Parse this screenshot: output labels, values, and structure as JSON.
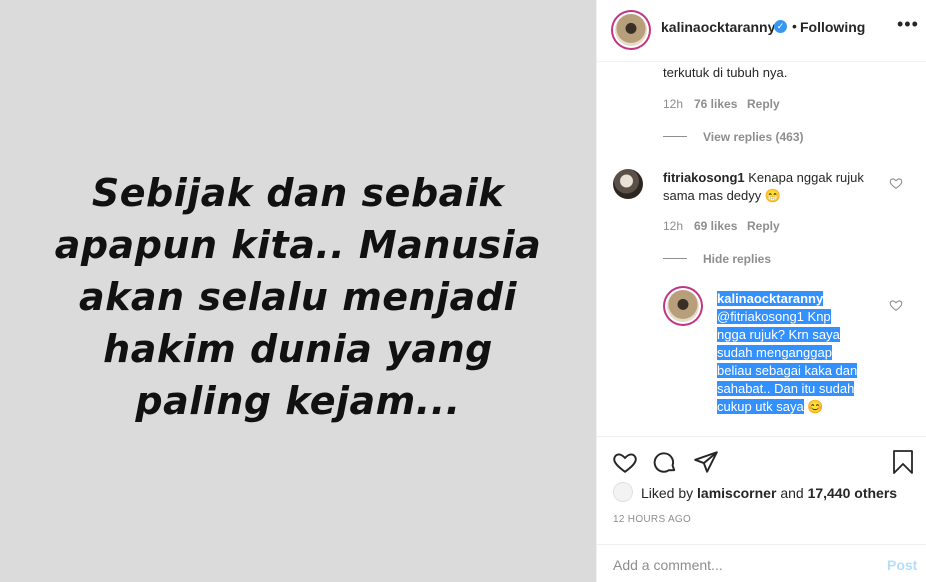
{
  "post_image": {
    "quote_lines": [
      "Sebijak dan sebaik",
      "apapun kita.. Manusia",
      "akan selalu menjadi",
      "hakim dunia yang",
      "paling kejam..."
    ]
  },
  "header": {
    "username": "kalinaocktaranny",
    "separator": "•",
    "follow_status": "Following",
    "more_icon": "more-horizontal-icon"
  },
  "comments": {
    "prev_tail": {
      "text": "terkutuk di tubuh nya.",
      "time": "12h",
      "likes": "76 likes",
      "reply": "Reply",
      "view_replies": "View replies (463)"
    },
    "fitri": {
      "username": "fitriakosong1",
      "text_line1": "Kenapa nggak rujuk",
      "text_line2": "sama mas dedyy 😁",
      "time": "12h",
      "likes": "69 likes",
      "reply": "Reply",
      "hide_replies": "Hide replies"
    },
    "owner_reply": {
      "username": "kalinaocktaranny",
      "lines": [
        "@fitriakosong1 Knp",
        "ngga rujuk? Krn saya",
        "sudah menganggap",
        "beliau sebagai kaka dan",
        "sahabat.. Dan itu sudah",
        "cukup utk saya"
      ],
      "emoji": "😊"
    }
  },
  "actions": {
    "liked_prefix": "Liked by",
    "liked_user": "lamiscorner",
    "liked_and": "and",
    "liked_count": "17,440 others",
    "timestamp": "12 HOURS AGO"
  },
  "add_comment": {
    "placeholder": "Add a comment...",
    "post_label": "Post"
  },
  "colors": {
    "accent": "#3897f0",
    "selection": "#3390ff",
    "muted": "#8e8e8e",
    "image_bg": "#dbdbdb"
  }
}
